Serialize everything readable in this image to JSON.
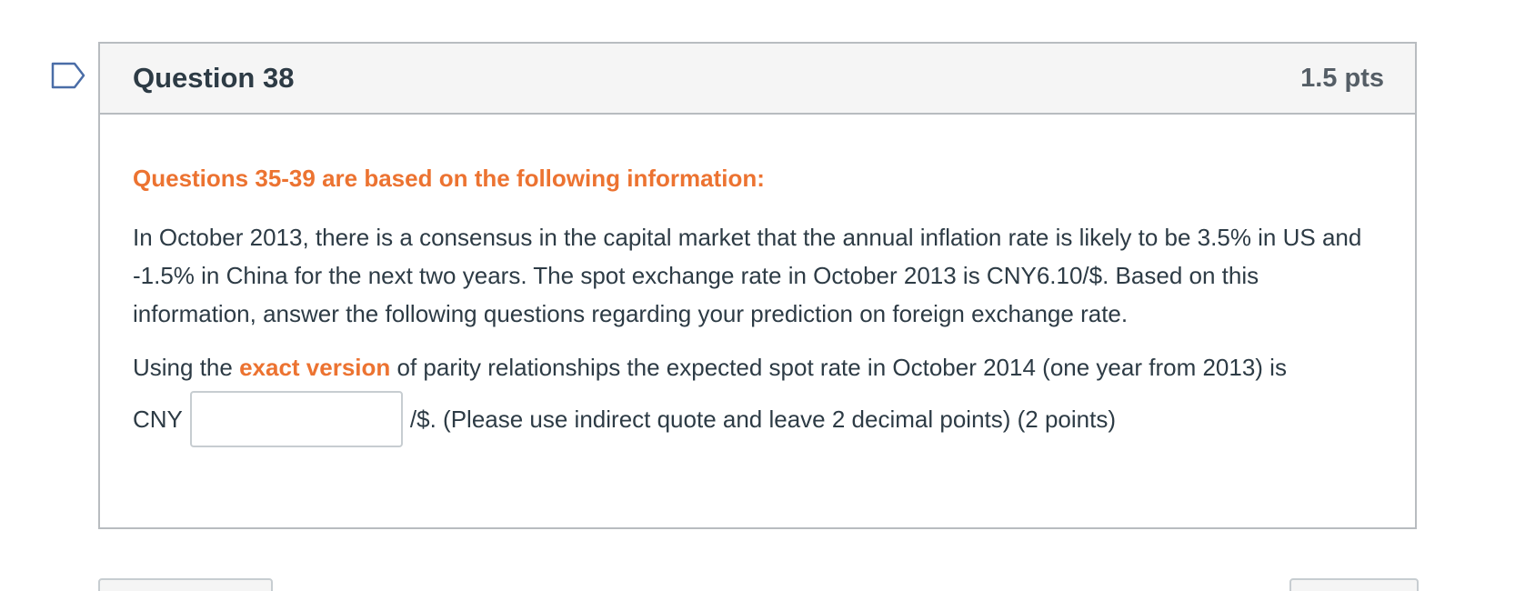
{
  "question": {
    "title": "Question 38",
    "points": "1.5 pts",
    "flag_icon": "flag-outline-icon"
  },
  "body": {
    "info_heading": "Questions 35-39 are based on the following information:",
    "info_paragraph": "In October 2013, there is a consensus in the capital market that the annual inflation rate is likely to be 3.5% in US and -1.5% in China for the next two years. The spot exchange rate in October 2013 is CNY6.10/$. Based on this information, answer the following questions regarding your prediction on foreign exchange rate.",
    "prompt_before": "Using the ",
    "prompt_highlight": "exact version",
    "prompt_after": " of parity relationships the expected spot rate in October 2014 (one year from 2013) is",
    "answer_prefix": "CNY",
    "answer_value": "",
    "answer_suffix": "/$. (Please use indirect quote and leave 2 decimal points) (2 points)"
  },
  "colors": {
    "accent": "#ec7331",
    "border": "#b8bcc0",
    "header_bg": "#f5f5f5",
    "flag": "#4a6da7"
  }
}
